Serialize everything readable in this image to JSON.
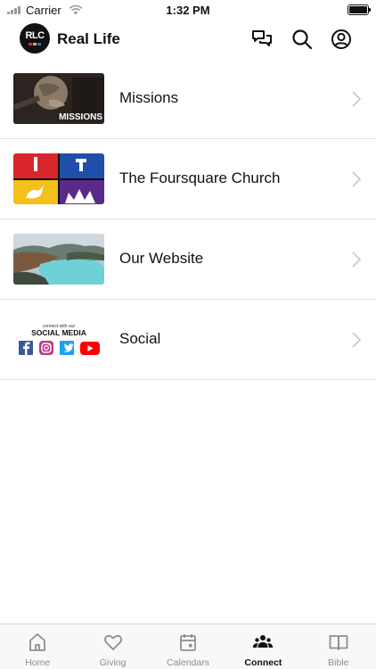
{
  "status_bar": {
    "carrier": "Carrier",
    "time": "1:32 PM"
  },
  "header": {
    "logo_text": "RLC",
    "title": "Real Life",
    "icons": [
      "chat-icon",
      "search-icon",
      "account-icon"
    ]
  },
  "list": [
    {
      "label": "Missions",
      "thumb_text": "MISSIONS",
      "icon": "chevron-right-icon"
    },
    {
      "label": "The Foursquare Church",
      "icon": "chevron-right-icon"
    },
    {
      "label": "Our Website",
      "icon": "chevron-right-icon"
    },
    {
      "label": "Social",
      "thumb_small": "connect with our",
      "thumb_title": "SOCIAL MEDIA",
      "icon": "chevron-right-icon"
    }
  ],
  "tabs": [
    {
      "label": "Home",
      "icon": "home-icon",
      "active": false
    },
    {
      "label": "Giving",
      "icon": "heart-icon",
      "active": false
    },
    {
      "label": "Calendars",
      "icon": "calendar-icon",
      "active": false
    },
    {
      "label": "Connect",
      "icon": "people-icon",
      "active": true
    },
    {
      "label": "Bible",
      "icon": "book-icon",
      "active": false
    }
  ],
  "colors": {
    "active_tab": "#111111",
    "inactive_tab": "#8e8e93",
    "separator": "#e2e2e2"
  }
}
